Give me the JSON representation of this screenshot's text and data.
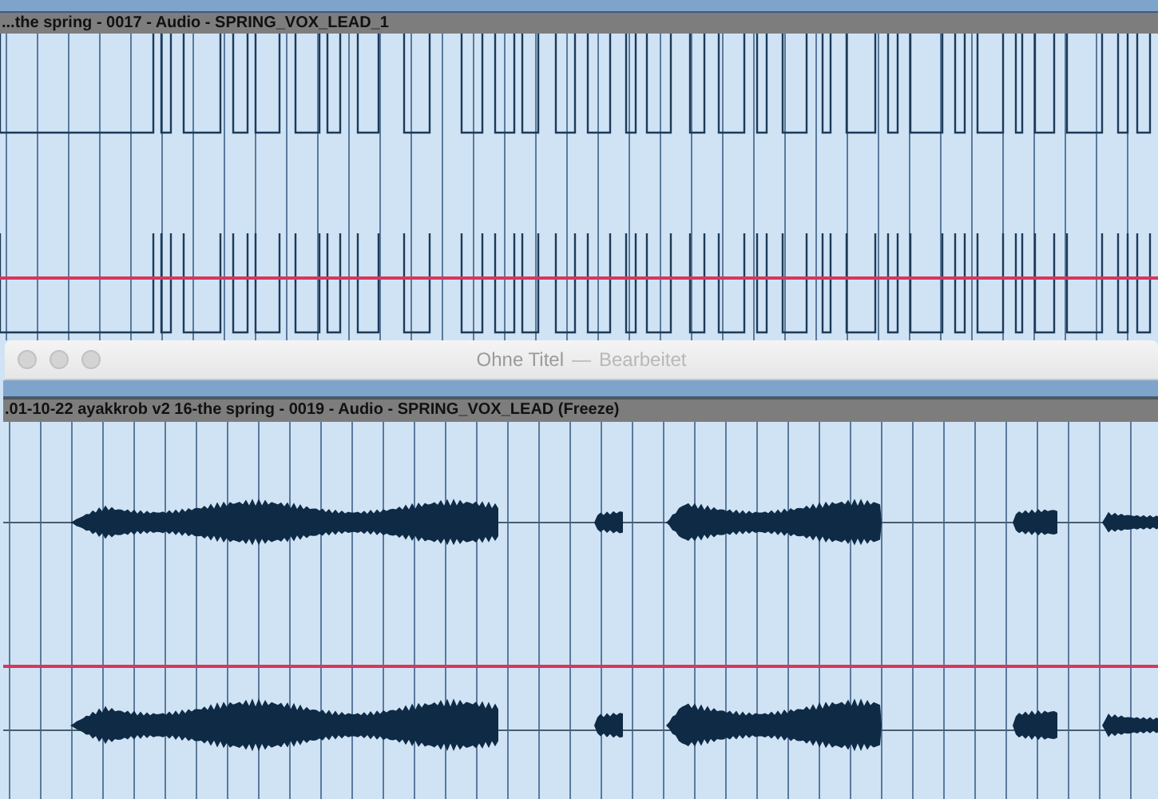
{
  "top_region": {
    "title": "...the spring - 0017 - Audio - SPRING_VOX_LEAD_1"
  },
  "window": {
    "title": "Ohne Titel",
    "separator": "—",
    "status": "Bearbeitet"
  },
  "bottom_region": {
    "title": ".01-10-22 ayakkrob v2 16-the spring - 0019 - Audio - SPRING_VOX_LEAD (Freeze)"
  }
}
